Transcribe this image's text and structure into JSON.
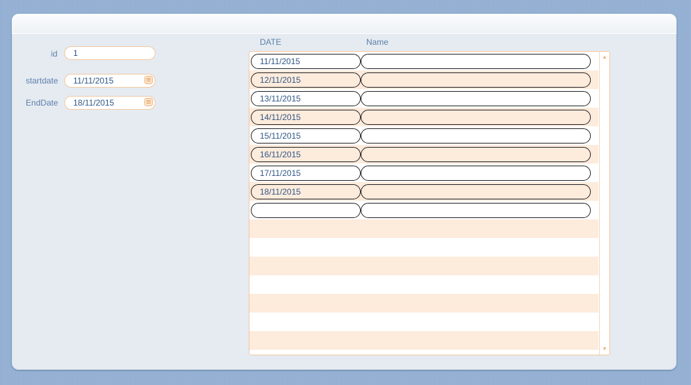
{
  "form": {
    "id_label": "id",
    "id_value": "1",
    "startdate_label": "startdate",
    "startdate_value": "11/11/2015",
    "enddate_label": "EndDate",
    "enddate_value": "18/11/2015"
  },
  "grid": {
    "columns": [
      "DATE",
      "Name"
    ],
    "rows": [
      {
        "date": "11/11/2015",
        "name": ""
      },
      {
        "date": "12/11/2015",
        "name": ""
      },
      {
        "date": "13/11/2015",
        "name": ""
      },
      {
        "date": "14/11/2015",
        "name": ""
      },
      {
        "date": "15/11/2015",
        "name": ""
      },
      {
        "date": "16/11/2015",
        "name": ""
      },
      {
        "date": "17/11/2015",
        "name": ""
      },
      {
        "date": "18/11/2015",
        "name": ""
      },
      {
        "date": "",
        "name": ""
      }
    ]
  },
  "icons": {
    "calendar": "calendar-icon",
    "scroll_up": "scroll-up-arrow-icon",
    "scroll_down": "scroll-down-arrow-icon"
  },
  "colors": {
    "label_text": "#5c7fab",
    "field_border": "#f4c79f",
    "stripe": "#fdebdc",
    "panel_bg": "#e5ebf1"
  }
}
